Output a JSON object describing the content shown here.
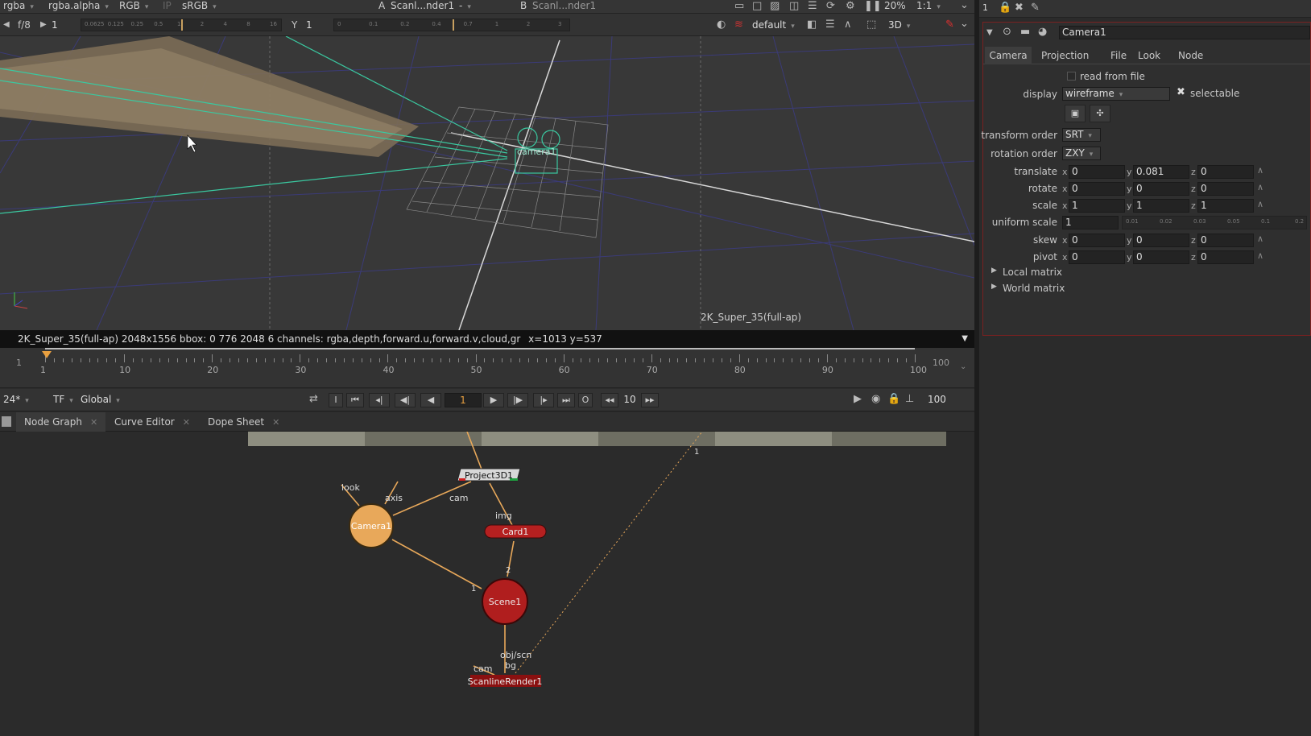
{
  "viewer": {
    "channels": "rgba",
    "alpha": "rgba.alpha",
    "colorspace_mode": "RGB",
    "ip": "IP",
    "lut": "sRGB",
    "input_a_label": "A",
    "input_a": "Scanl...nder1",
    "input_a_op": "-",
    "input_b_label": "B",
    "input_b": "Scanl...nder1",
    "zoom": "20%",
    "ratio": "1:1",
    "fstop": "f/8",
    "gain_value": "1",
    "gamma_label": "Y",
    "gamma_value": "1",
    "gain_ticks": [
      "0.0625",
      "0.125",
      "0.25",
      "0.5",
      "1",
      "2",
      "4",
      "8",
      "16"
    ],
    "gamma_ticks": [
      "0",
      "0.1",
      "0.2",
      "0.4",
      "0.7",
      "1",
      "2",
      "3"
    ],
    "camera_mode": "default",
    "view_mode": "3D",
    "camera_label": "camera1",
    "format_label": "2K_Super_35(full-ap)"
  },
  "infobar": {
    "text": "2K_Super_35(full-ap) 2048x1556  bbox: 0 776 2048 6 channels: rgba,depth,forward.u,forward.v,cloud,gr",
    "coords": "x=1013 y=537"
  },
  "timeline": {
    "start": "1",
    "ticks": [
      "1",
      "10",
      "20",
      "30",
      "40",
      "50",
      "60",
      "70",
      "80",
      "90",
      "100"
    ],
    "end": "100",
    "current_frame": "1",
    "fps": "24*",
    "tf": "TF",
    "scope": "Global",
    "step": "10",
    "last": "100"
  },
  "tabs": [
    {
      "label": "Node Graph"
    },
    {
      "label": "Curve Editor"
    },
    {
      "label": "Dope Sheet"
    }
  ],
  "nodes": {
    "project": "Project3D1",
    "card": "Card1",
    "camera": "Camera1",
    "scene": "Scene1",
    "render": "ScanlineRender1",
    "edge_look": "look",
    "edge_axis": "axis",
    "edge_cam": "cam",
    "edge_img": "img",
    "edge_card_in": "2",
    "edge_scene_in": "1",
    "edge_obj": "obj/scn",
    "edge_bg": "bg",
    "edge_render_cam": "cam",
    "edge_dot": "1"
  },
  "props": {
    "top_index": "1",
    "node_name": "Camera1",
    "tabs": [
      "Camera",
      "Projection",
      "File",
      "Look",
      "Node"
    ],
    "read_from_file": "read from file",
    "display_label": "display",
    "display_value": "wireframe",
    "selectable_label": "selectable",
    "transform_order_label": "transform order",
    "transform_order_value": "SRT",
    "rotation_order_label": "rotation order",
    "rotation_order_value": "ZXY",
    "rows": [
      {
        "label": "translate",
        "x": "0",
        "y": "0.081",
        "z": "0"
      },
      {
        "label": "rotate",
        "x": "0",
        "y": "0",
        "z": "0"
      },
      {
        "label": "scale",
        "x": "1",
        "y": "1",
        "z": "1"
      }
    ],
    "uniform_scale_label": "uniform scale",
    "uniform_scale_value": "1",
    "uniform_ticks": [
      "0.01",
      "0.02",
      "0.03",
      "0.05",
      "0.1",
      "0.2"
    ],
    "rows2": [
      {
        "label": "skew",
        "x": "0",
        "y": "0",
        "z": "0"
      },
      {
        "label": "pivot",
        "x": "0",
        "y": "0",
        "z": "0"
      }
    ],
    "local_matrix": "Local matrix",
    "world_matrix": "World matrix",
    "axis_x": "x",
    "axis_y": "y",
    "axis_z": "z"
  },
  "colors": {
    "camera_node": "#e8a85a",
    "scene_node": "#b01e1e",
    "card_node": "#b52020",
    "wire": "#e8a85a",
    "panel_border": "#7a2020"
  }
}
